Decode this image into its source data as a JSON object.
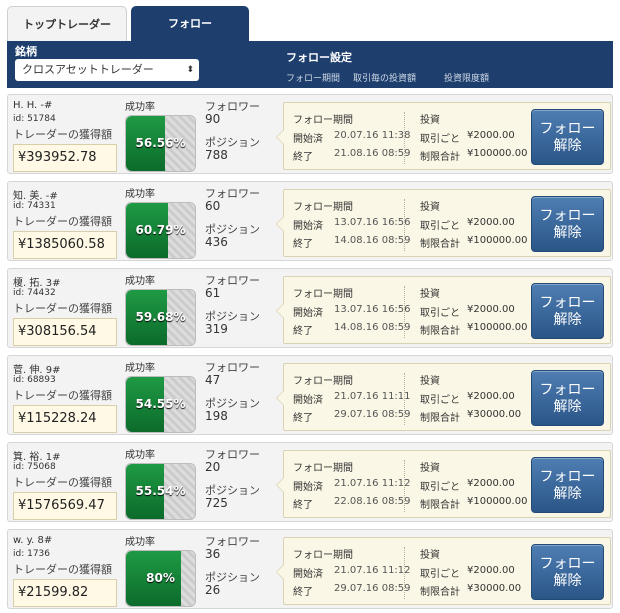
{
  "tabs": {
    "top_traders": "トップトレーダー",
    "follow": "フォロー"
  },
  "header": {
    "symbol_label": "銘柄",
    "select_value": "クロスアセットトレーダー",
    "follow_settings": "フォロー設定",
    "col_follow_period": "フォロー期間",
    "col_per_trade": "取引毎の投資額",
    "col_invest_limit": "投資限度額"
  },
  "labels": {
    "earnings": "トレーダーの獲得額",
    "success_rate": "成功率",
    "followers": "フォロワー",
    "positions": "ポジション",
    "follow_period": "フォロー期間",
    "started": "開始済",
    "ended": "終了",
    "investment": "投資",
    "per_trade": "取引ごと",
    "limit_total": "制限合計",
    "unfollow_line1": "フォロー",
    "unfollow_line2": "解除"
  },
  "traders": [
    {
      "name": "H. H.  -#",
      "id": "id: 51784",
      "earnings": "¥393952.78",
      "success": "56.56%",
      "success_fraction": 0.5656,
      "followers": "90",
      "positions": "788",
      "start": "20.07.16 11:38",
      "end": "21.08.16 08:59",
      "per_trade": "¥2000.00",
      "limit": "¥100000.00"
    },
    {
      "name": "知. 美.  -#",
      "id": "id: 74331",
      "earnings": "¥1385060.58",
      "success": "60.79%",
      "success_fraction": 0.6079,
      "followers": "60",
      "positions": "436",
      "start": "13.07.16 16:56",
      "end": "14.08.16 08:59",
      "per_trade": "¥2000.00",
      "limit": "¥100000.00"
    },
    {
      "name": "榎. 拓.  3#",
      "id": "id: 74432",
      "earnings": "¥308156.54",
      "success": "59.68%",
      "success_fraction": 0.5968,
      "followers": "61",
      "positions": "319",
      "start": "13.07.16 16:56",
      "end": "14.08.16 08:59",
      "per_trade": "¥2000.00",
      "limit": "¥100000.00"
    },
    {
      "name": "菅. 伸.  9#",
      "id": "id: 68893",
      "earnings": "¥115228.24",
      "success": "54.55%",
      "success_fraction": 0.5455,
      "followers": "47",
      "positions": "198",
      "start": "21.07.16 11:11",
      "end": "29.07.16 08:59",
      "per_trade": "¥2000.00",
      "limit": "¥30000.00"
    },
    {
      "name": "箕. 裕.  1#",
      "id": "id: 75068",
      "earnings": "¥1576569.47",
      "success": "55.54%",
      "success_fraction": 0.5554,
      "followers": "20",
      "positions": "725",
      "start": "21.07.16 11:12",
      "end": "22.08.16 08:59",
      "per_trade": "¥2000.00",
      "limit": "¥100000.00"
    },
    {
      "name": "w. y.  8#",
      "id": "id: 1736",
      "earnings": "¥21599.82",
      "success": "80%",
      "success_fraction": 0.8,
      "followers": "36",
      "positions": "26",
      "start": "21.07.16 11:12",
      "end": "29.07.16 08:59",
      "per_trade": "¥2000.00",
      "limit": "¥30000.00"
    }
  ]
}
